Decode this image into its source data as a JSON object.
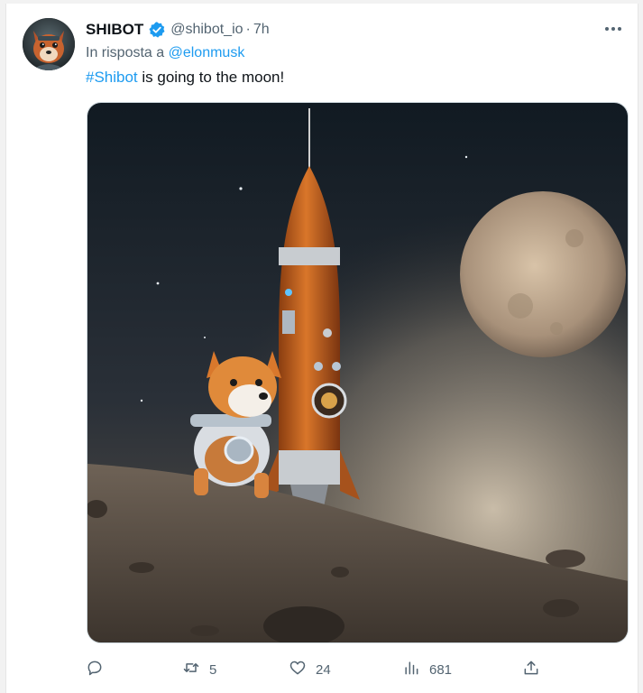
{
  "tweet": {
    "author": {
      "name": "SHIBOT",
      "handle": "@shibot_io",
      "verified": true,
      "avatar": "shiba-astronaut-avatar"
    },
    "separator": "·",
    "time": "7h",
    "reply_prefix": "In risposta a",
    "reply_to": "@elonmusk",
    "hashtag": "#Shibot",
    "text": " is going to the moon!",
    "media": {
      "description_icon": "shiba-rocket-moon-image"
    },
    "stats": {
      "replies": "",
      "retweets": "5",
      "likes": "24",
      "views": "681"
    }
  },
  "icons": {
    "more": "more-options-icon",
    "reply": "comment-icon",
    "retweet": "retweet-icon",
    "like": "heart-icon",
    "views": "analytics-icon",
    "share": "share-icon"
  },
  "colors": {
    "accent": "#1d9bf0",
    "text": "#0f1419",
    "muted": "#536471"
  }
}
